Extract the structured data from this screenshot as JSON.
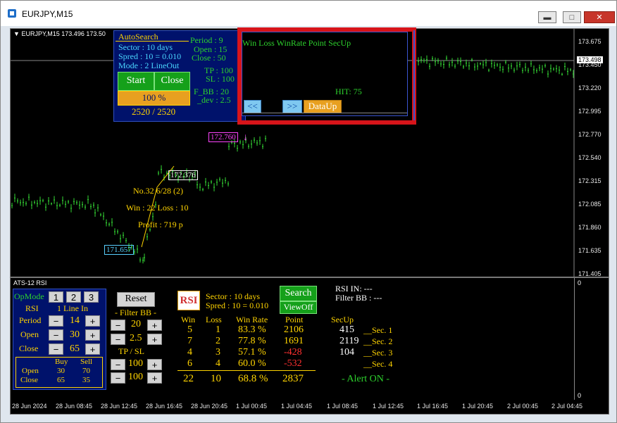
{
  "window": {
    "title": "EURJPY,M15",
    "min_icon": "minimize-icon",
    "max_icon": "maximize-icon",
    "close_icon": "close-icon"
  },
  "chart": {
    "header": "EURJPY,M15  173.496 173.50",
    "price_labels": [
      "173.675",
      "173.450",
      "173.220",
      "172.995",
      "172.770",
      "172.540",
      "172.315",
      "172.085",
      "171.860",
      "171.635",
      "171.405"
    ],
    "current_price": "173.498",
    "annotations": {
      "hi": "172.760",
      "mid": "172.376",
      "lo": "171.657"
    },
    "stats": {
      "line1": "No.32   6/28 (2)",
      "line2": "Win : 22   Loss : 10",
      "line3": "Profit : 719 p"
    }
  },
  "autosearch": {
    "title": "AutoSearch",
    "sector": "Sector : 10 days",
    "spred": "Spred : 10 = 0.010",
    "mode": "Mode : 2  LineOut",
    "start": "Start",
    "close": "Close",
    "progress": "100 %",
    "progress_value": 1.0,
    "count": "2520 / 2520",
    "period": "Period : 9",
    "open": "Open : 15",
    "closeval": "Close : 50",
    "tp": "TP : 100",
    "sl": "SL : 100",
    "fbb": "F_BB : 20",
    "dev": "_dev : 2.5"
  },
  "datapanel": {
    "header": "Win  Loss  WinRate  Point  SecUp",
    "hit": "HIT: 75",
    "prev": "<<",
    "next": ">>",
    "dataup": "DataUp"
  },
  "rsi": {
    "label": "ATS-12  RSI",
    "scale_top": "0",
    "scale_bottom": "0",
    "opmode": "OpMode",
    "opmode_btns": [
      "1",
      "2",
      "3"
    ],
    "rsi": "RSI",
    "line_in": "1  Line In",
    "period_label": "Period",
    "period_val": "14",
    "open_label": "Open",
    "open_val": "30",
    "close_label": "Close",
    "close_val": "65",
    "buy": "Buy",
    "sell": "Sell",
    "open_buy": "30",
    "open_sell": "70",
    "close_buy": "65",
    "close_sell": "35",
    "reset": "Reset",
    "filter_bb": "- Filter BB -",
    "bb1": "20",
    "bb2": "2.5",
    "tpsl": "TP  /  SL",
    "tp": "100",
    "sl": "100",
    "logo": "RSI",
    "sector": "Sector : 10 days",
    "spred": "Spred : 10 = 0.010",
    "search": "Search",
    "viewoff": "ViewOff",
    "rsi_in": "RSI IN: ---",
    "filter_bb2": "Filter BB   : ---",
    "table_headers": [
      "Win",
      "Loss",
      "Win Rate",
      "Point",
      "SecUp"
    ],
    "rows": [
      {
        "win": "5",
        "loss": "1",
        "rate": "83.3 %",
        "point": "2106",
        "secup": "415",
        "sec": "__Sec. 1"
      },
      {
        "win": "7",
        "loss": "2",
        "rate": "77.8 %",
        "point": "1691",
        "secup": "2119",
        "sec": "__Sec. 2"
      },
      {
        "win": "4",
        "loss": "3",
        "rate": "57.1 %",
        "point": "-428",
        "secup": "104",
        "sec": "__Sec. 3"
      },
      {
        "win": "6",
        "loss": "4",
        "rate": "60.0 %",
        "point": "-532",
        "secup": "",
        "sec": "__Sec. 4"
      }
    ],
    "total": {
      "win": "22",
      "loss": "10",
      "rate": "68.8 %",
      "point": "2837"
    },
    "alert": "- Alert ON -"
  },
  "time_labels": [
    "28 Jun 2024",
    "28 Jun 08:45",
    "28 Jun 12:45",
    "28 Jun 16:45",
    "28 Jun 20:45",
    "1 Jul 00:45",
    "1 Jul 04:45",
    "1 Jul 08:45",
    "1 Jul 12:45",
    "1 Jul 16:45",
    "1 Jul 20:45",
    "2 Jul 00:45",
    "2 Jul 04:45"
  ]
}
